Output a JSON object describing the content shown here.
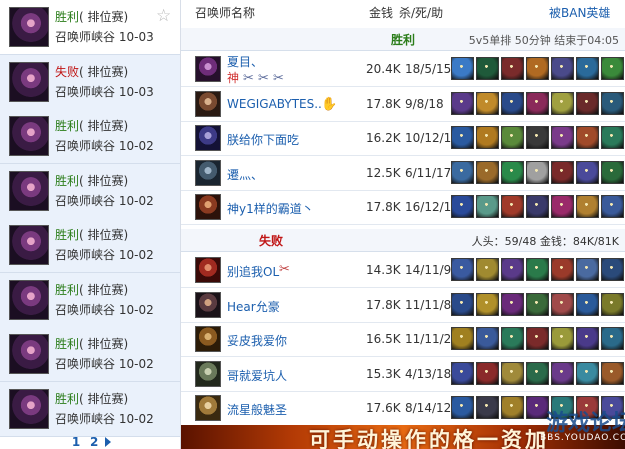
{
  "matches": [
    {
      "result": "胜利",
      "result_class": "win",
      "type": "( 排位赛)",
      "map": "召唤师峡谷",
      "date": "10-03",
      "selected": true,
      "starred": true
    },
    {
      "result": "失败",
      "result_class": "loss",
      "type": "( 排位赛)",
      "map": "召唤师峡谷",
      "date": "10-03",
      "selected": false,
      "starred": false
    },
    {
      "result": "胜利",
      "result_class": "win",
      "type": "( 排位赛)",
      "map": "召唤师峡谷",
      "date": "10-02",
      "selected": false,
      "starred": false
    },
    {
      "result": "胜利",
      "result_class": "win",
      "type": "( 排位赛)",
      "map": "召唤师峡谷",
      "date": "10-02",
      "selected": false,
      "starred": false
    },
    {
      "result": "胜利",
      "result_class": "win",
      "type": "( 排位赛)",
      "map": "召唤师峡谷",
      "date": "10-02",
      "selected": false,
      "starred": false
    },
    {
      "result": "胜利",
      "result_class": "win",
      "type": "( 排位赛)",
      "map": "召唤师峡谷",
      "date": "10-02",
      "selected": false,
      "starred": false
    },
    {
      "result": "胜利",
      "result_class": "win",
      "type": "( 排位赛)",
      "map": "召唤师峡谷",
      "date": "10-02",
      "selected": false,
      "starred": false
    },
    {
      "result": "胜利",
      "result_class": "win",
      "type": "( 排位赛)",
      "map": "召唤师峡谷",
      "date": "10-02",
      "selected": false,
      "starred": false
    }
  ],
  "pager": {
    "page1": "1",
    "page2": "2"
  },
  "header": {
    "name_col": "召唤师名称",
    "gold_col": "金钱",
    "kda_col": "杀/死/助",
    "ban_link": "被BAN英雄"
  },
  "win_team": {
    "title": "胜利",
    "info": "5v5单排  50分钟  结束于04:05",
    "players": [
      {
        "name": "夏目、",
        "name2": "神",
        "gold": "20.4K",
        "kda": "18/5/15",
        "avatar": [
          "#c88fd0",
          "#6e2d7a",
          "#26102c"
        ],
        "items": [
          "#3b7ac6",
          "#1f5a3a",
          "#7a2b2b",
          "#b06a22",
          "#4a4a8a",
          "#2a6a9a",
          "#3a8a3a"
        ]
      },
      {
        "name": "WEGIGABYTES..",
        "gold": "17.8K",
        "kda": "9/8/18",
        "avatar": [
          "#d9b08c",
          "#7a4a30",
          "#2a1a12"
        ],
        "items": [
          "#5a3a8a",
          "#c08a2a",
          "#2a4a8a",
          "#8a2a5a",
          "#a0a040",
          "#6a2a2a",
          "#2a5a7a"
        ]
      },
      {
        "name": "朕给你下面吃",
        "gold": "16.2K",
        "kda": "10/12/15",
        "avatar": [
          "#a8a0d8",
          "#3d3a86",
          "#141236"
        ],
        "items": [
          "#2a5aa0",
          "#b07a20",
          "#5a8a3a",
          "#3a3a3a",
          "#7a3a8a",
          "#a04a2a",
          "#2a7a5a"
        ]
      },
      {
        "name": "遷灬、",
        "gold": "12.5K",
        "kda": "6/11/17",
        "avatar": [
          "#9fb5c8",
          "#445b6e",
          "#1a2530"
        ],
        "items": [
          "#3a6aa0",
          "#9a6a2a",
          "#2a8a4a",
          "#a0a0a0",
          "#7a2a2a",
          "#4a4a9a",
          "#2a6a3a"
        ]
      },
      {
        "name": "神y1样的霸道丶",
        "gold": "17.8K",
        "kda": "16/12/14",
        "avatar": [
          "#e0a070",
          "#8a3a20",
          "#2c120a"
        ],
        "items": [
          "#2a4a9a",
          "#5a9a8a",
          "#a03a2a",
          "#3a3a6a",
          "#9a2a6a",
          "#b08030",
          "#3a5a9a"
        ]
      }
    ]
  },
  "lose_team": {
    "title": "失败",
    "info": "人头：59/48 金钱：84K/81K",
    "players": [
      {
        "name": "别追我OL",
        "gold": "14.3K",
        "kda": "14/11/9",
        "avatar": [
          "#e08a6a",
          "#a02a20",
          "#3a0a08"
        ],
        "items": [
          "#3a5aa0",
          "#a08a30",
          "#5a3a8a",
          "#2a7a4a",
          "#9a3a2a",
          "#4a6aa0",
          "#2a4a7a"
        ]
      },
      {
        "name": "Hear允豪",
        "gold": "17.8K",
        "kda": "11/11/8",
        "avatar": [
          "#d0a080",
          "#5a3a40",
          "#1a1218"
        ],
        "items": [
          "#2a4a8a",
          "#b0902a",
          "#6a2a7a",
          "#3a6a3a",
          "#a04a4a",
          "#2a5a9a",
          "#7a7a2a"
        ]
      },
      {
        "name": "妥皮我爱你",
        "gold": "16.5K",
        "kda": "11/11/20",
        "avatar": [
          "#d8b070",
          "#8a5a20",
          "#2c1c08"
        ],
        "items": [
          "#a08020",
          "#3a5a9a",
          "#2a7a5a",
          "#7a2a2a",
          "#9a9a3a",
          "#4a3a8a",
          "#2a6a8a"
        ]
      },
      {
        "name": "哥就爱坑人",
        "gold": "15.3K",
        "kda": "4/13/18",
        "avatar": [
          "#c8d0b0",
          "#6a7a5a",
          "#22281c"
        ],
        "items": [
          "#3a4a9a",
          "#8a2a2a",
          "#a08a3a",
          "#2a6a4a",
          "#6a3a8a",
          "#3a8aa0",
          "#9a5a2a"
        ]
      },
      {
        "name": "流星般魅圣",
        "gold": "17.6K",
        "kda": "8/14/12",
        "avatar": [
          "#e8d0a0",
          "#a07a3a",
          "#3a2a10"
        ],
        "items": [
          "#2a5aa0",
          "#3a3a4a",
          "#a0802a",
          "#5a2a7a",
          "#2a7a7a",
          "#9a3a3a",
          "#4a4a9a"
        ]
      }
    ]
  },
  "banner": {
    "text": "可手动操作的格一资加"
  },
  "watermark": {
    "main": "游戏论坛",
    "sub": "BBS.YOUDAO.COM"
  }
}
